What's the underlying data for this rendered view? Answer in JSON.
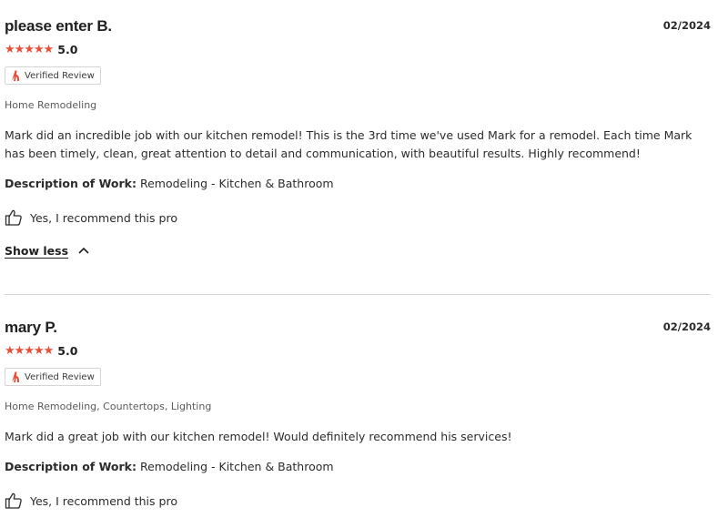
{
  "reviews": [
    {
      "name": "please enter B.",
      "date": "02/2024",
      "rating_score": "5.0",
      "stars": 5,
      "verified_label": "Verified Review",
      "services": "Home Remodeling",
      "body": "Mark did an incredible job with our kitchen remodel! This is the 3rd time we've used Mark for a remodel. Each time Mark has been timely, clean, great attention to detail and communication, with beautiful results. Highly recommend!",
      "description_label": "Description of Work:",
      "description_value": "Remodeling - Kitchen & Bathroom",
      "recommend_text": "Yes, I recommend this pro",
      "show_less": "Show less"
    },
    {
      "name": "mary P.",
      "date": "02/2024",
      "rating_score": "5.0",
      "stars": 5,
      "verified_label": "Verified Review",
      "services": "Home Remodeling, Countertops, Lighting",
      "body": "Mark did a great job with our kitchen remodel! Would definitely recommend his services!",
      "description_label": "Description of Work:",
      "description_value": "Remodeling - Kitchen & Bathroom",
      "recommend_text": "Yes, I recommend this pro"
    }
  ],
  "colors": {
    "star": "#e8503a",
    "brand_logo": "#e8503a",
    "divider": "#d6d6d6"
  },
  "icons": {
    "star": "star-icon",
    "brand": "angi-logo-icon",
    "thumbs_up": "thumbs-up-icon",
    "chevron": "chevron-up-icon"
  }
}
